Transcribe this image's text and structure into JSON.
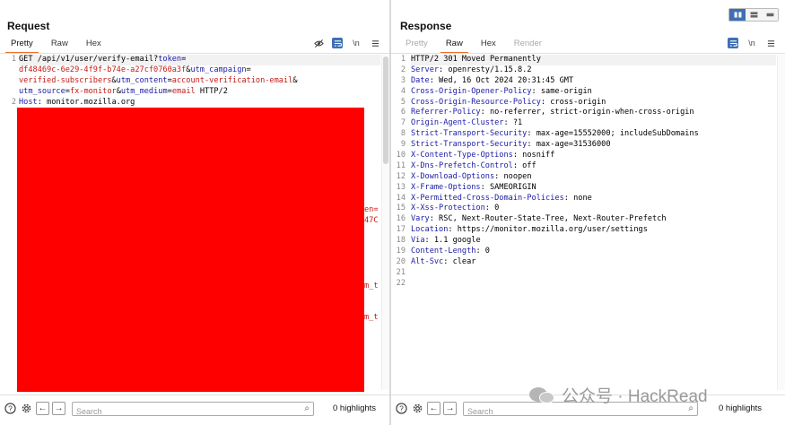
{
  "request": {
    "title": "Request",
    "tabs": [
      "Pretty",
      "Raw",
      "Hex"
    ],
    "active_tab": "Pretty",
    "tool_newline": "\\n",
    "gutter": [
      "1",
      "",
      "",
      "",
      "2"
    ],
    "lines": [
      [
        {
          "t": "GET /api/v1/user/verify-email?"
        },
        {
          "t": "token",
          "c": "k"
        },
        {
          "t": "="
        }
      ],
      [
        {
          "t": "df48469c-6e29-4f9f-b74e-a27cf0760a3f",
          "c": "v"
        },
        {
          "t": "&"
        },
        {
          "t": "utm_campaign",
          "c": "k"
        },
        {
          "t": "="
        }
      ],
      [
        {
          "t": "verified-subscribers",
          "c": "v"
        },
        {
          "t": "&"
        },
        {
          "t": "utm_content",
          "c": "k"
        },
        {
          "t": "="
        },
        {
          "t": "account-verification-email",
          "c": "v"
        },
        {
          "t": "&"
        }
      ],
      [
        {
          "t": "utm_source",
          "c": "k"
        },
        {
          "t": "="
        },
        {
          "t": "fx-monitor",
          "c": "v"
        },
        {
          "t": "&"
        },
        {
          "t": "utm_medium",
          "c": "k"
        },
        {
          "t": "="
        },
        {
          "t": "email",
          "c": "v"
        },
        {
          "t": " HTTP/2"
        }
      ],
      [
        {
          "t": "Host",
          "c": "k"
        },
        {
          "t": ": monitor.mozilla.org"
        }
      ]
    ],
    "partial_fragments": [
      "en=",
      "47C",
      "m_t",
      "m_t"
    ],
    "search_placeholder": "Search",
    "highlights": "0 highlights"
  },
  "response": {
    "title": "Response",
    "tabs": [
      "Pretty",
      "Raw",
      "Hex",
      "Render"
    ],
    "active_tab": "Raw",
    "tool_newline": "\\n",
    "lines": [
      [
        {
          "t": "HTTP/2 301 Moved Permanently"
        }
      ],
      [
        {
          "t": "Server",
          "c": "k"
        },
        {
          "t": ": openresty/1.15.8.2"
        }
      ],
      [
        {
          "t": "Date",
          "c": "k"
        },
        {
          "t": ": Wed, 16 Oct 2024 20:31:45 GMT"
        }
      ],
      [
        {
          "t": "Cross-Origin-Opener-Policy",
          "c": "k"
        },
        {
          "t": ": same-origin"
        }
      ],
      [
        {
          "t": "Cross-Origin-Resource-Policy",
          "c": "k"
        },
        {
          "t": ": cross-origin"
        }
      ],
      [
        {
          "t": "Referrer-Policy",
          "c": "k"
        },
        {
          "t": ": no-referrer, strict-origin-when-cross-origin"
        }
      ],
      [
        {
          "t": "Origin-Agent-Cluster",
          "c": "k"
        },
        {
          "t": ": ?1"
        }
      ],
      [
        {
          "t": "Strict-Transport-Security",
          "c": "k"
        },
        {
          "t": ": max-age=15552000; includeSubDomains"
        }
      ],
      [
        {
          "t": "Strict-Transport-Security",
          "c": "k"
        },
        {
          "t": ": max-age=31536000"
        }
      ],
      [
        {
          "t": "X-Content-Type-Options",
          "c": "k"
        },
        {
          "t": ": nosniff"
        }
      ],
      [
        {
          "t": "X-Dns-Prefetch-Control",
          "c": "k"
        },
        {
          "t": ": off"
        }
      ],
      [
        {
          "t": "X-Download-Options",
          "c": "k"
        },
        {
          "t": ": noopen"
        }
      ],
      [
        {
          "t": "X-Frame-Options",
          "c": "k"
        },
        {
          "t": ": SAMEORIGIN"
        }
      ],
      [
        {
          "t": "X-Permitted-Cross-Domain-Policies",
          "c": "k"
        },
        {
          "t": ": none"
        }
      ],
      [
        {
          "t": "X-Xss-Protection",
          "c": "k"
        },
        {
          "t": ": 0"
        }
      ],
      [
        {
          "t": "Vary",
          "c": "k"
        },
        {
          "t": ": RSC, Next-Router-State-Tree, Next-Router-Prefetch"
        }
      ],
      [
        {
          "t": "Location",
          "c": "k"
        },
        {
          "t": ": https://monitor.mozilla.org/user/settings"
        }
      ],
      [
        {
          "t": "Via",
          "c": "k"
        },
        {
          "t": ": 1.1 google"
        }
      ],
      [
        {
          "t": "Content-Length",
          "c": "k"
        },
        {
          "t": ": 0"
        }
      ],
      [
        {
          "t": "Alt-Svc",
          "c": "k"
        },
        {
          "t": ": clear"
        }
      ],
      [],
      []
    ],
    "search_placeholder": "Search",
    "highlights": "0 highlights"
  },
  "watermark": "公众号 · HackRead",
  "colors": {
    "accent_tab": "#e8702a",
    "toggle_active": "#3f6fb4",
    "header_key": "#1a1aa6",
    "param_value": "#c41a16",
    "redaction": "#ff0000"
  },
  "icons": {
    "hide": "eye-off-icon",
    "wrap": "wrap-lines-icon",
    "newline": "newline-icon",
    "menu": "hamburger-menu-icon",
    "help": "help-icon",
    "settings": "gear-icon",
    "back": "arrow-left-icon",
    "forward": "arrow-right-icon",
    "search": "search-icon"
  }
}
